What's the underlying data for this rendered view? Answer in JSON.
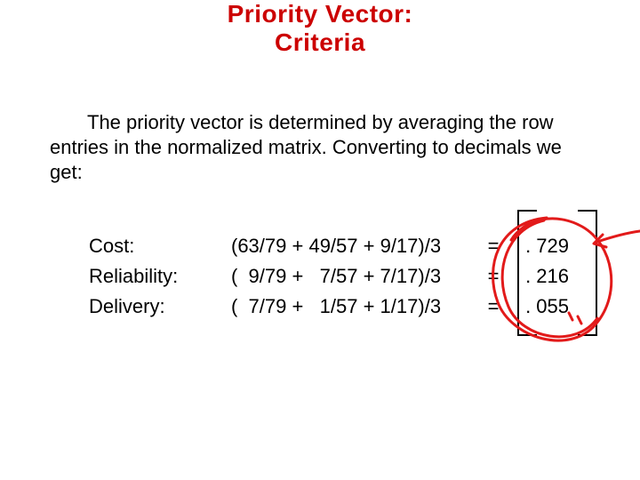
{
  "title_line1": "Priority Vector:",
  "title_line2": "Criteria",
  "paragraph": "The priority vector is determined by averaging the row entries in the normalized matrix.  Converting to decimals we get:",
  "rows": [
    {
      "label": "Cost:",
      "expr": "(63/79 + 49/57 + 9/17)/3",
      "eq": "=",
      "val": ". 729"
    },
    {
      "label": "Reliability:",
      "expr": "(  9/79 +   7/57 + 7/17)/3",
      "eq": "=",
      "val": ". 216"
    },
    {
      "label": "Delivery:",
      "expr": "(  7/79 +   1/57 + 1/17)/3",
      "eq": "=",
      "val": ". 055"
    }
  ],
  "annotation": {
    "color": "#e21a1a",
    "type": "hand-drawn-circle-with-arrow"
  }
}
